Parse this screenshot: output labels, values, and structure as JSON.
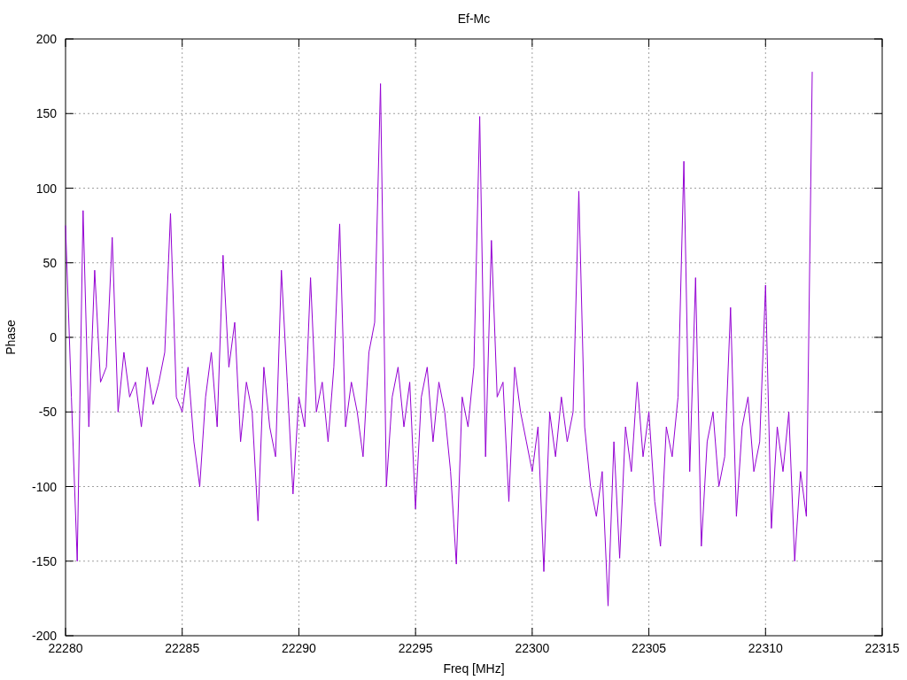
{
  "chart_data": {
    "type": "line",
    "grid": true,
    "title": "Ef-Mc",
    "xlabel": "Freq [MHz]",
    "ylabel": "Phase",
    "xlim": [
      22280,
      22315
    ],
    "ylim": [
      -200,
      200
    ],
    "xticks": [
      22280,
      22285,
      22290,
      22295,
      22300,
      22305,
      22310,
      22315
    ],
    "yticks": [
      -200,
      -150,
      -100,
      -50,
      0,
      50,
      100,
      150,
      200
    ],
    "x": [
      22280,
      22280.25,
      22280.5,
      22280.75,
      22281,
      22281.25,
      22281.5,
      22281.75,
      22282,
      22282.25,
      22282.5,
      22282.75,
      22283,
      22283.25,
      22283.5,
      22283.75,
      22284,
      22284.25,
      22284.5,
      22284.75,
      22285,
      22285.25,
      22285.5,
      22285.75,
      22286,
      22286.25,
      22286.5,
      22286.75,
      22287,
      22287.25,
      22287.5,
      22287.75,
      22288,
      22288.25,
      22288.5,
      22288.75,
      22289,
      22289.25,
      22289.5,
      22289.75,
      22290,
      22290.25,
      22290.5,
      22290.75,
      22291,
      22291.25,
      22291.5,
      22291.75,
      22292,
      22292.25,
      22292.5,
      22292.75,
      22293,
      22293.25,
      22293.5,
      22293.75,
      22294,
      22294.25,
      22294.5,
      22294.75,
      22295,
      22295.25,
      22295.5,
      22295.75,
      22296,
      22296.25,
      22296.5,
      22296.75,
      22297,
      22297.25,
      22297.5,
      22297.75,
      22298,
      22298.25,
      22298.5,
      22298.75,
      22299,
      22299.25,
      22299.5,
      22299.75,
      22300,
      22300.25,
      22300.5,
      22300.75,
      22301,
      22301.25,
      22301.5,
      22301.75,
      22302,
      22302.25,
      22302.5,
      22302.75,
      22303,
      22303.25,
      22303.5,
      22303.75,
      22304,
      22304.25,
      22304.5,
      22304.75,
      22305,
      22305.25,
      22305.5,
      22305.75,
      22306,
      22306.25,
      22306.5,
      22306.75,
      22307,
      22307.25,
      22307.5,
      22307.75,
      22308,
      22308.25,
      22308.5,
      22308.75,
      22309,
      22309.25,
      22309.5,
      22309.75,
      22310,
      22310.25,
      22310.5,
      22310.75,
      22311,
      22311.25,
      22311.5,
      22311.75,
      22312
    ],
    "series": [
      {
        "color": "#9400d3",
        "values": [
          75,
          -40,
          -150,
          85,
          -60,
          45,
          -30,
          -20,
          67,
          -50,
          -10,
          -40,
          -30,
          -60,
          -20,
          -45,
          -30,
          -10,
          83,
          -40,
          -50,
          -20,
          -70,
          -100,
          -40,
          -10,
          -60,
          55,
          -20,
          10,
          -70,
          -30,
          -50,
          -123,
          -20,
          -60,
          -80,
          45,
          -30,
          -105,
          -40,
          -60,
          40,
          -50,
          -30,
          -70,
          -20,
          76,
          -60,
          -30,
          -50,
          -80,
          -10,
          10,
          170,
          -100,
          -40,
          -20,
          -60,
          -30,
          -115,
          -40,
          -20,
          -70,
          -30,
          -50,
          -90,
          -152,
          -40,
          -60,
          -20,
          148,
          -80,
          65,
          -40,
          -30,
          -110,
          -20,
          -50,
          -70,
          -90,
          -60,
          -157,
          -50,
          -80,
          -40,
          -70,
          -50,
          98,
          -60,
          -100,
          -120,
          -90,
          -180,
          -70,
          -148,
          -60,
          -90,
          -30,
          -80,
          -50,
          -110,
          -140,
          -60,
          -80,
          -40,
          118,
          -90,
          40,
          -140,
          -70,
          -50,
          -100,
          -80,
          20,
          -120,
          -60,
          -40,
          -90,
          -70,
          35,
          -128,
          -60,
          -90,
          -50,
          -150,
          -90,
          -120,
          178
        ]
      }
    ]
  }
}
